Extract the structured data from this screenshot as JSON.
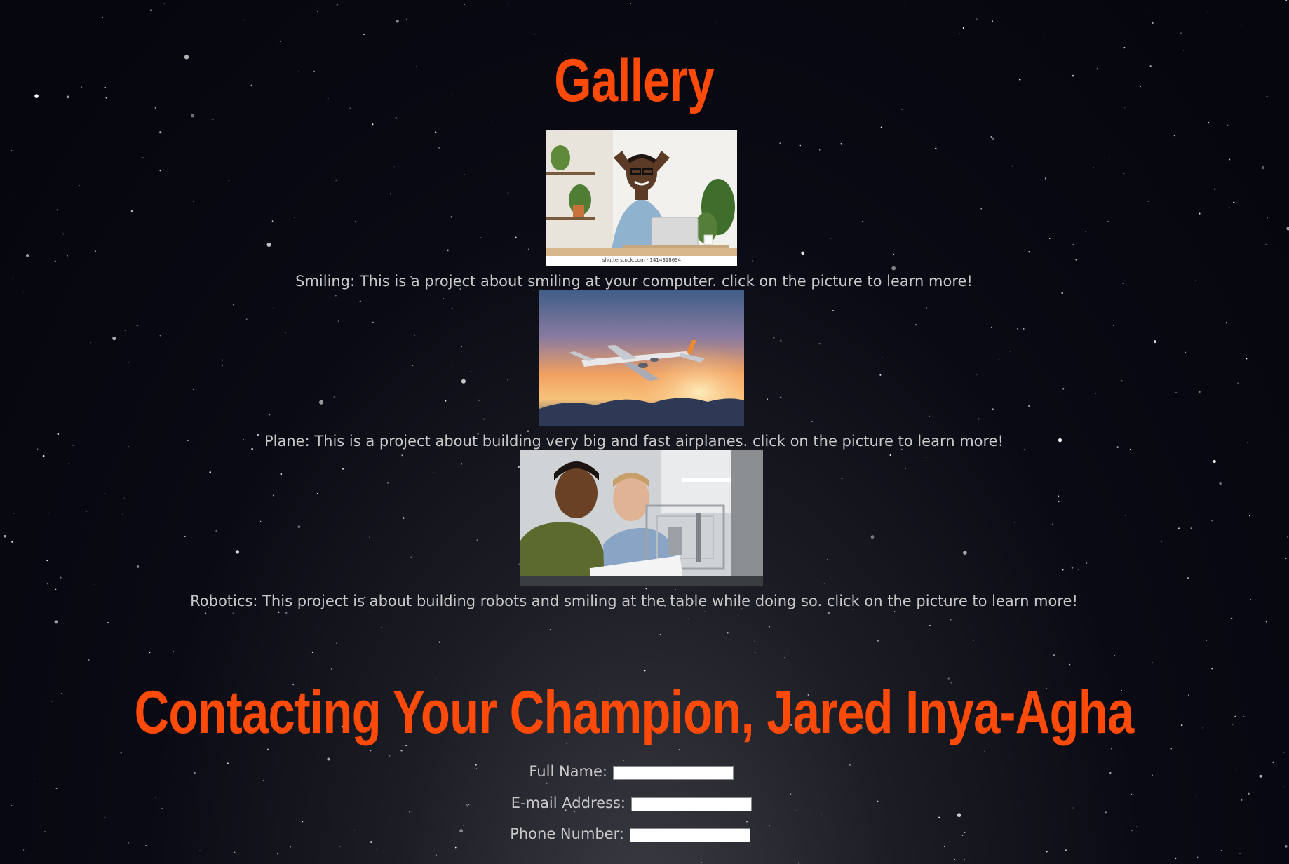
{
  "gallery": {
    "title": "Gallery",
    "items": [
      {
        "image_icon": "photo-man-smiling-at-laptop",
        "watermark": "shutterstock.com · 1414318694",
        "caption": "Smiling: This is a project about smiling at your computer. click on the picture to learn more!"
      },
      {
        "image_icon": "photo-airplane-sunset",
        "caption": "Plane: This is a project about building very big and fast airplanes. click on the picture to learn more!"
      },
      {
        "image_icon": "photo-students-robotics",
        "caption": "Robotics: This project is about building robots and smiling at the table while doing so. click on the picture to learn more!"
      }
    ]
  },
  "contact": {
    "title": "Contacting Your Champion, Jared Inya-Agha",
    "fields": [
      {
        "label": "Full Name:",
        "value": ""
      },
      {
        "label": "E-mail Address:",
        "value": ""
      },
      {
        "label": "Phone Number:",
        "value": ""
      }
    ]
  },
  "colors": {
    "heading": "#ff4a0a",
    "text": "#c8c8c8",
    "background": "#05050d"
  }
}
